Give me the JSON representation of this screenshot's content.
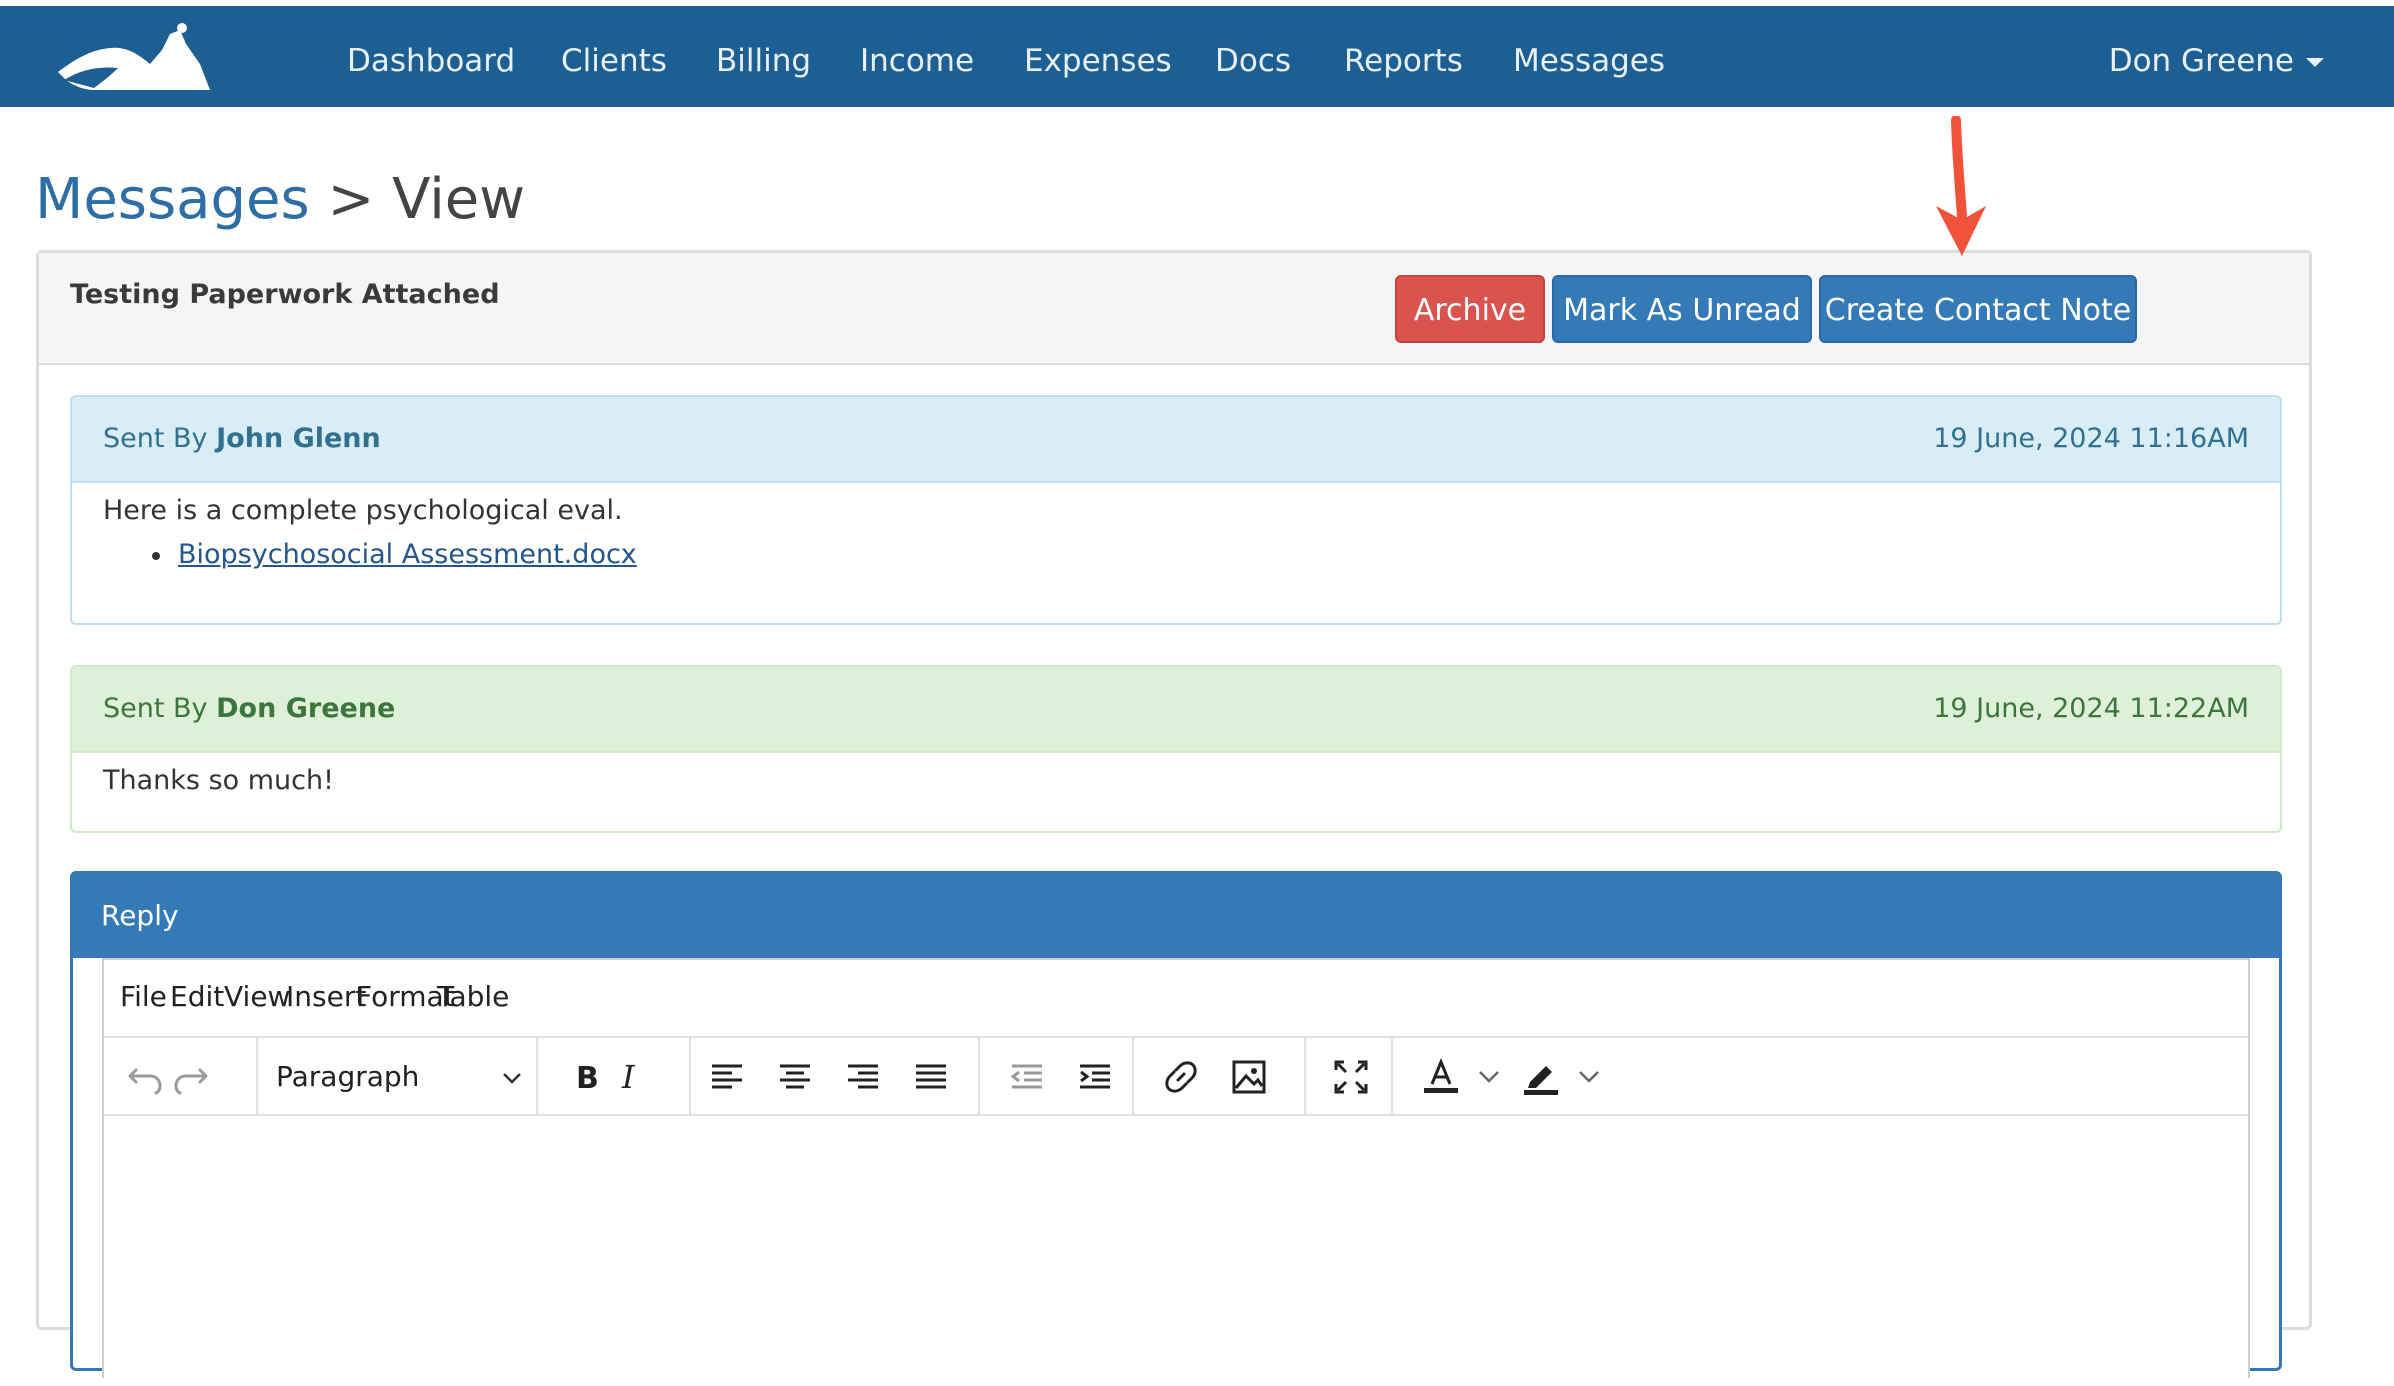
{
  "nav": {
    "items": [
      "Dashboard",
      "Clients",
      "Billing",
      "Income",
      "Expenses",
      "Docs",
      "Reports",
      "Messages"
    ],
    "user": "Don Greene"
  },
  "page": {
    "crumb": "Messages",
    "separator": ">",
    "current": "View"
  },
  "message": {
    "subject": "Testing Paperwork Attached",
    "actions": {
      "archive": "Archive",
      "mark_unread": "Mark As Unread",
      "create_note": "Create Contact Note"
    }
  },
  "thread": [
    {
      "sent_by_label": "Sent By",
      "sender": "John Glenn",
      "timestamp": "19 June, 2024 11:16AM",
      "body": "Here is a complete psychological eval.",
      "attachment": "Biopsychosocial Assessment.docx"
    },
    {
      "sent_by_label": "Sent By",
      "sender": "Don Greene",
      "timestamp": "19 June, 2024 11:22AM",
      "body": "Thanks so much!"
    }
  ],
  "reply": {
    "title": "Reply",
    "menu": [
      "File",
      "Edit",
      "View",
      "Insert",
      "Format",
      "Table"
    ],
    "block_format": "Paragraph"
  },
  "colors": {
    "navbar": "#1d5f93",
    "primary": "#337ab7",
    "danger": "#d9534f",
    "annotation_arrow": "#f0533a"
  }
}
